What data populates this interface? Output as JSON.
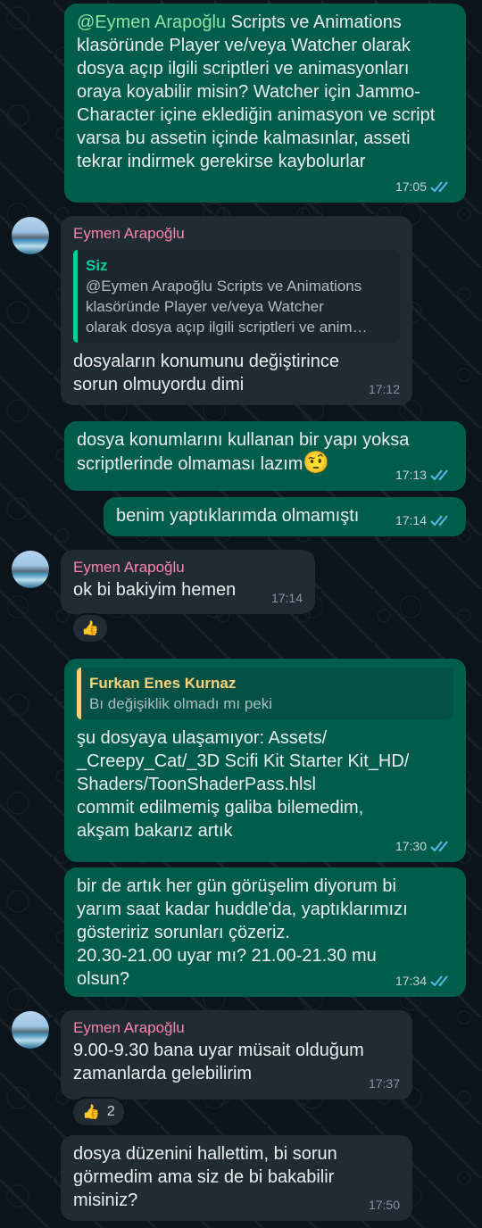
{
  "messages": [
    {
      "mention": "@Eymen Arapoğlu",
      "text": " Scripts ve Animations klasöründe Player ve/veya Watcher olarak dosya açıp ilgili scriptleri ve animasyonları oraya koyabilir misin? Watcher için Jammo-Character içine eklediğin animasyon ve script varsa bu assetin içinde kalmasınlar, asseti tekrar indirmek gerekirse kaybolurlar",
      "time": "17:05"
    },
    {
      "sender": "Eymen Arapoğlu",
      "quote_author": "Siz",
      "quote_text": "@Eymen Arapoğlu Scripts ve Animations\nklasöründe Player ve/veya Watcher\nolarak dosya açıp ilgili scriptleri ve anim…",
      "text": "dosyaların konumunu değiştirince\nsorun olmuyordu dimi",
      "time": "17:12"
    },
    {
      "text": "dosya konumlarını kullanan bir yapı yoksa\nscriptlerinde olmaması lazım",
      "emoji": "🤨",
      "time": "17:13"
    },
    {
      "text": "benim yaptıklarımda olmamıştı",
      "time": "17:14"
    },
    {
      "sender": "Eymen Arapoğlu",
      "text": "ok bi bakiyim hemen",
      "time": "17:14",
      "reaction": "👍"
    },
    {
      "quote_author": "Furkan Enes Kurnaz",
      "quote_text": "Bı değişiklik olmadı mı peki",
      "text": "şu dosyaya ulaşamıyor: Assets/\n_Creepy_Cat/_3D Scifi Kit Starter Kit_HD/\nShaders/ToonShaderPass.hlsl\ncommit edilmemiş galiba bilemedim,\nakşam bakarız artık",
      "time": "17:30"
    },
    {
      "text": "bir de artık her gün görüşelim diyorum bi\nyarım saat kadar huddle'da, yaptıklarımızı\ngösteririz sorunları çözeriz.\n20.30-21.00 uyar mı? 21.00-21.30 mu\nolsun?",
      "time": "17:34"
    },
    {
      "sender": "Eymen Arapoğlu",
      "text": "9.00-9.30 bana uyar müsait olduğum\nzamanlarda gelebilirim",
      "time": "17:37",
      "reaction": "👍",
      "reaction_count": "2"
    },
    {
      "text": "dosya düzenini hallettim, bi sorun\ngörmedim ama siz de bi bakabilir\nmisiniz?",
      "time": "17:50"
    }
  ],
  "colors": {
    "outgoing": "#005c4b",
    "incoming": "#202c33",
    "sender_name": "#ff80ab",
    "read_ticks": "#53bdeb"
  }
}
